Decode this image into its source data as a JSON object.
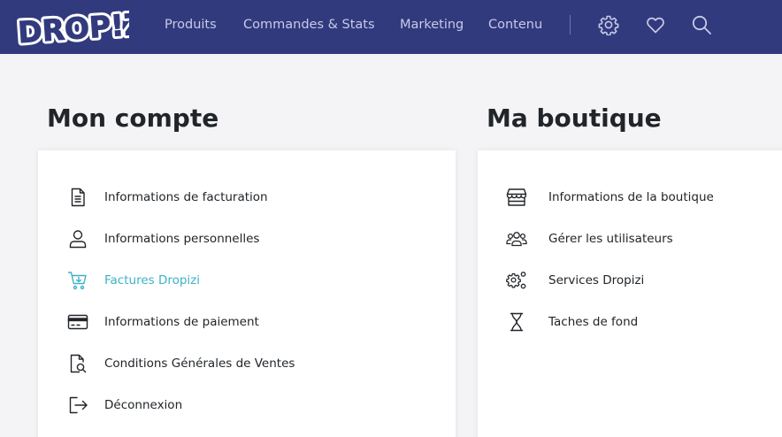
{
  "brand": {
    "logo_text": "DROP!ZI"
  },
  "nav": {
    "links": [
      "Produits",
      "Commandes & Stats",
      "Marketing",
      "Contenu"
    ],
    "icons": [
      "gear-icon",
      "heart-icon",
      "search-icon"
    ]
  },
  "account": {
    "title": "Mon compte",
    "items": [
      {
        "label": "Informations de facturation",
        "icon": "document-icon"
      },
      {
        "label": "Informations personnelles",
        "icon": "user-icon"
      },
      {
        "label": "Factures Dropizi",
        "icon": "cart-icon",
        "active": true
      },
      {
        "label": "Informations de paiement",
        "icon": "credit-card-icon"
      },
      {
        "label": "Conditions Générales de Ventes",
        "icon": "document-search-icon"
      },
      {
        "label": "Déconnexion",
        "icon": "logout-icon"
      }
    ]
  },
  "shop": {
    "title": "Ma boutique",
    "items": [
      {
        "label": "Informations de la boutique",
        "icon": "store-icon"
      },
      {
        "label": "Gérer les utilisateurs",
        "icon": "users-icon"
      },
      {
        "label": "Services Dropizi",
        "icon": "gears-icon"
      },
      {
        "label": "Taches de fond",
        "icon": "hourglass-icon"
      }
    ]
  },
  "colors": {
    "topbar": "#323a7e",
    "accent": "#3eb1c8",
    "nav_text": "#c7cae6",
    "background": "#f4f4f6"
  }
}
